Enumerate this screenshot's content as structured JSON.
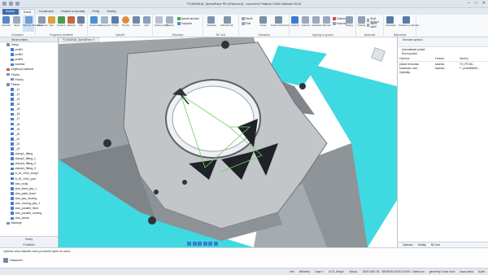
{
  "window": {
    "title": "FCAM2618_SpinalFace Pin (Pracovní) - rozvržení Feature CAM Ultimate 2018",
    "controls": [
      "–",
      "□",
      "✕"
    ]
  },
  "tabs": [
    {
      "label": "Soubor",
      "style": "file"
    },
    {
      "label": "Domů",
      "style": "active"
    },
    {
      "label": "Konstrukce",
      "style": ""
    },
    {
      "label": "Feature a obrobky",
      "style": ""
    },
    {
      "label": "Prvky",
      "style": ""
    },
    {
      "label": "Grafiky",
      "style": ""
    }
  ],
  "ribbon": {
    "groups": [
      {
        "label": "Zobrazení",
        "buttons": [
          "Zobrazit",
          "Skrýt",
          "Stínové zobrazení"
        ]
      },
      {
        "label": "Programy obrábění",
        "buttons": [
          "Montovat",
          "Nov.",
          "Feature",
          "Nástroj",
          "API"
        ]
      },
      {
        "label": "Vytvořit",
        "buttons": [
          "Geometrie",
          "Spojovací",
          "Křivky",
          "Plochy",
          "Ostatní",
          "Ostr."
        ]
      },
      {
        "label": "Simulace",
        "buttons": [
          "Nástroj (NC)",
          "Nástroj"
        ],
        "smalls": [
          "Spustit simulaci",
          "Toolpaths"
        ]
      },
      {
        "label": "NC kód",
        "buttons": [
          "Výsledky",
          "Zobrazit NC"
        ]
      },
      {
        "label": "Schránka",
        "buttons": [
          "Kopie",
          "Kopírovat plochy"
        ],
        "smalls": [
          "Stavět",
          "Řídit"
        ]
      },
      {
        "label": "Výpočty a správa",
        "buttons": [
          "Vyberat",
          "Vyberat",
          "Výsledek",
          "Zapnout",
          "Dialog"
        ],
        "smalls": [
          "Odstranit",
          "Hodnota"
        ]
      },
      {
        "label": "Možnosti",
        "buttons": [
          "Úprava"
        ],
        "smalls": [
          "Skrýt vyjmout",
          "Zavřít výběr"
        ]
      },
      {
        "label": "Nápověda",
        "buttons": [
          "Autodesk",
          "Světelné podmínky"
        ]
      }
    ]
  },
  "left_panel": {
    "header": "Strom vrstev",
    "items": [
      {
        "label": "Vrstvy",
        "indent": 1,
        "color": "#7a8ea8"
      },
      {
        "label": "profil1",
        "indent": 2,
        "color": "#4a7ac8"
      },
      {
        "label": "profil2",
        "indent": 2,
        "color": "#4a7ac8"
      },
      {
        "label": "profil3",
        "indent": 2,
        "color": "#4a7ac8"
      },
      {
        "label": "kazeta1",
        "indent": 2,
        "color": "#4a7ac8"
      },
      {
        "label": "Zbytkový materiál",
        "indent": 1,
        "color": "#c85a3a"
      },
      {
        "label": "Plochy",
        "indent": 1,
        "color": "#7a8ea8"
      },
      {
        "label": "Plochy",
        "indent": 2,
        "color": "#7a8ea8"
      },
      {
        "label": "Tělesa",
        "indent": 1,
        "color": "#7a8ea8"
      },
      {
        "label": "_11",
        "indent": 2,
        "color": "#4a7ac8"
      },
      {
        "label": "_12",
        "indent": 2,
        "color": "#4a7ac8"
      },
      {
        "label": "_13",
        "indent": 2,
        "color": "#4a7ac8"
      },
      {
        "label": "_14",
        "indent": 2,
        "color": "#4a7ac8"
      },
      {
        "label": "_15",
        "indent": 2,
        "color": "#4a7ac8"
      },
      {
        "label": "_16",
        "indent": 2,
        "color": "#4a7ac8"
      },
      {
        "label": "_17",
        "indent": 2,
        "color": "#4a7ac8"
      },
      {
        "label": "_18",
        "indent": 2,
        "color": "#4a7ac8"
      },
      {
        "label": "_19",
        "indent": 2,
        "color": "#4a7ac8"
      },
      {
        "label": "_20",
        "indent": 2,
        "color": "#4a7ac8"
      },
      {
        "label": "_21",
        "indent": 2,
        "color": "#4a7ac8"
      },
      {
        "label": "_22",
        "indent": 2,
        "color": "#4a7ac8"
      },
      {
        "label": "_23",
        "indent": 2,
        "color": "#4a7ac8"
      },
      {
        "label": "clamp1_fitting",
        "indent": 2,
        "color": "#4a7ac8"
      },
      {
        "label": "clamp2_fitting_1",
        "indent": 2,
        "color": "#4a7ac8"
      },
      {
        "label": "clamp3_fitting_2",
        "indent": 2,
        "color": "#4a7ac8"
      },
      {
        "label": "clamp4_fitting_3",
        "indent": 2,
        "color": "#4a7ac8"
      },
      {
        "label": "m_fit_1004_body1",
        "indent": 2,
        "color": "#4a7ac8"
      },
      {
        "label": "m_fit_1004_part",
        "indent": 2,
        "color": "#4a7ac8"
      },
      {
        "label": "vise_body",
        "indent": 2,
        "color": "#4a7ac8"
      },
      {
        "label": "vise_fixed_jaw_1",
        "indent": 2,
        "color": "#4a7ac8"
      },
      {
        "label": "vise_plate_fixed",
        "indent": 2,
        "color": "#4a7ac8"
      },
      {
        "label": "vise_jaw_moving",
        "indent": 2,
        "color": "#4a7ac8"
      },
      {
        "label": "vise_moving_jaw_1",
        "indent": 2,
        "color": "#4a7ac8"
      },
      {
        "label": "vise_parallel_fixed",
        "indent": 2,
        "color": "#4a7ac8"
      },
      {
        "label": "vise_parallel_moving",
        "indent": 2,
        "color": "#4a7ac8"
      },
      {
        "label": "vise_screw",
        "indent": 2,
        "color": "#4a7ac8"
      },
      {
        "label": "Nástroje",
        "indent": 1,
        "color": "#7a8ea8"
      }
    ],
    "footer_tabs": [
      "Vrstvy",
      "Prohlížeč"
    ]
  },
  "viewport": {
    "doc_tab": "FCAM2618_SpinalFace  ✕"
  },
  "right_panel": {
    "label": "Seznam operací",
    "options": [
      "Automatické pořadí",
      "Ruční pořadí"
    ],
    "columns": [
      "Operace",
      "Feature",
      "Nástroj"
    ],
    "rows": [
      [
        "plošné frézování",
        "kazeta1",
        "TO_RF-6D..."
      ],
      [
        "hrubování: obě...",
        "kazeta1",
        "**_endmill6000..."
      ],
      [
        "Výsledky",
        "",
        ""
      ]
    ],
    "bottom_tabs": [
      "Operace",
      "Detaily",
      "NC kód"
    ]
  },
  "message": {
    "hint": "Vyberte nebo klikněte nebo proveďte výběr do okna",
    "note": "Nastavení"
  },
  "status": {
    "items": [
      "Mm",
      "Milimetry",
      "Layer 1",
      "UCS_Setup1",
      "Setup1",
      "DMG DMU 50 - SIEMENS 840D 5-AXIS - Dateil.cnc",
      "geometry 3-axis ruční",
      "kaca.ceska",
      "A jiná"
    ]
  },
  "colors": {
    "vise_cyan": "#3fd9e2",
    "part_gray": "#b9bcc0",
    "toolpath_green": "#6fcf5a",
    "accent_blue": "#3a6db5"
  }
}
